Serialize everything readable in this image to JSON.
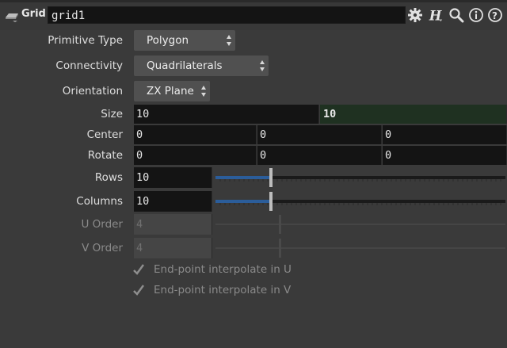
{
  "header": {
    "node_type": "Grid",
    "node_name": "grid1",
    "icons": [
      "node-type-icon",
      "gear-icon",
      "houdini-help-icon",
      "search-icon",
      "info-icon",
      "help-icon"
    ]
  },
  "parameters": {
    "primitive_type": {
      "label": "Primitive Type",
      "value": "Polygon"
    },
    "connectivity": {
      "label": "Connectivity",
      "value": "Quadrilaterals"
    },
    "orientation": {
      "label": "Orientation",
      "value": "ZX Plane"
    },
    "size": {
      "label": "Size",
      "values": [
        "10",
        "10"
      ]
    },
    "center": {
      "label": "Center",
      "values": [
        "0",
        "0",
        "0"
      ]
    },
    "rotate": {
      "label": "Rotate",
      "values": [
        "0",
        "0",
        "0"
      ]
    },
    "rows": {
      "label": "Rows",
      "value": "10",
      "slider_fraction": 0.19
    },
    "columns": {
      "label": "Columns",
      "value": "10",
      "slider_fraction": 0.19
    },
    "u_order": {
      "label": "U Order",
      "value": "4",
      "disabled": true
    },
    "v_order": {
      "label": "V Order",
      "value": "4",
      "disabled": true
    },
    "endpoint_u": {
      "label": "End-point interpolate in U",
      "checked": true,
      "disabled": true
    },
    "endpoint_v": {
      "label": "End-point interpolate in V",
      "checked": true,
      "disabled": true
    }
  },
  "colors": {
    "background": "#3a3a3a",
    "field": "#141414",
    "menu": "#505050",
    "accent_green": "#1f3121",
    "slider_fill": "#2b5d9a"
  }
}
